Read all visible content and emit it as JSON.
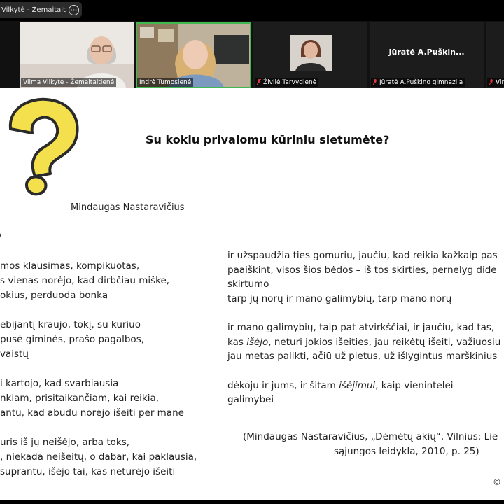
{
  "share_bar": {
    "title": "Vilkytė - Žemaitaitienė's sc",
    "more_icon": "more-horizontal-icon"
  },
  "participants": [
    {
      "name": "Vilma Vilkytė - Žemaitaitienė",
      "muted": false,
      "active": false
    },
    {
      "name": "Indrė Tumosienė",
      "muted": false,
      "active": true
    },
    {
      "name": "Živilė Tarvydienė",
      "muted": true,
      "active": false
    },
    {
      "name": "Jūratė A.Puškino gimnazija",
      "display_name": "Jūratė A.Puškin...",
      "muted": true,
      "active": false
    },
    {
      "name": "Vir",
      "muted": true,
      "active": false
    }
  ],
  "slide": {
    "title": "Su kokiu privalomu kūriniu sietumėte?",
    "author": "Mindaugas Nastaravičius",
    "poem_heading": "o",
    "left_column": [
      "mos klausimas, kompikuotas,",
      "s vienas norėjo, kad dirbčiau miške,",
      "okius, perduoda bonką",
      "",
      "ebijantį kraujo, tokį, su kuriuo",
      "pusė giminės, prašo pagalbos,",
      "vaistų",
      "",
      "i kartojo, kad svarbiausia",
      "nkiam, prisitaikančiam, kai reikia,",
      "antu, kad abudu norėjo išeiti per mane",
      "",
      "uris iš jų neišėjo, arba toks,",
      ", niekada neišeitų, o dabar, kai paklausia,",
      "suprantu, išėjo tai, kas neturėjo išeiti"
    ],
    "right_column": [
      {
        "parts": [
          {
            "t": "ir užspaudžia ties gomuriu, jaučiu, kad reikia kažkaip pas"
          }
        ]
      },
      {
        "parts": [
          {
            "t": "paaiškint, visos šios bėdos – iš tos skirties, pernelyg dide"
          }
        ]
      },
      {
        "parts": [
          {
            "t": " skirtumo"
          }
        ]
      },
      {
        "parts": [
          {
            "t": "tarp jų norų ir mano galimybių, tarp mano norų"
          }
        ]
      },
      {
        "parts": []
      },
      {
        "parts": [
          {
            "t": "ir mano galimybių, taip pat atvirkščiai, ir jaučiu, kad tas,"
          }
        ]
      },
      {
        "parts": [
          {
            "t": "kas "
          },
          {
            "t": "išėjo",
            "i": true
          },
          {
            "t": ", neturi jokios išeities, jau reikėtų išeiti, važiuosiu"
          }
        ]
      },
      {
        "parts": [
          {
            "t": "jau metas palikti, ačiū už pietus, už išlygintus marškinius"
          }
        ]
      },
      {
        "parts": []
      },
      {
        "parts": [
          {
            "t": "dėkoju ir jums, ir šitam "
          },
          {
            "t": "išėjimui",
            "i": true
          },
          {
            "t": ", kaip vienintelei"
          }
        ]
      },
      {
        "parts": [
          {
            "t": "galimybei"
          }
        ]
      }
    ],
    "citation": [
      "(Mindaugas Nastaravičius, „Dėmėtų akių“, Vilnius: Lie",
      "sąjungos leidykla, 2010, p. 25)"
    ],
    "copyright": "©",
    "qmark_icon": "question-mark-icon",
    "colors": {
      "qmark_fill": "#f4e04d",
      "qmark_stroke": "#2a2a2a",
      "active_speaker": "#3fb950",
      "muted": "#e0383e"
    }
  }
}
